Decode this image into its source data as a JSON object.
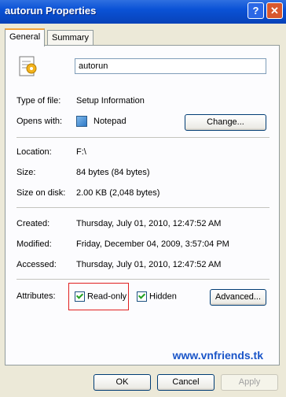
{
  "window": {
    "title": "autorun Properties",
    "help_label": "?",
    "close_label": "✕"
  },
  "tabs": [
    {
      "label": "General"
    },
    {
      "label": "Summary"
    }
  ],
  "file": {
    "name": "autorun",
    "icon": "setup-info-icon"
  },
  "fields": {
    "type_label": "Type of file:",
    "type_value": "Setup Information",
    "opens_label": "Opens with:",
    "opens_value": "Notepad",
    "change_button": "Change...",
    "location_label": "Location:",
    "location_value": "F:\\",
    "size_label": "Size:",
    "size_value": "84 bytes (84 bytes)",
    "size_on_disk_label": "Size on disk:",
    "size_on_disk_value": "2.00 KB (2,048 bytes)",
    "created_label": "Created:",
    "created_value": "Thursday, July 01, 2010, 12:47:52 AM",
    "modified_label": "Modified:",
    "modified_value": "Friday, December 04, 2009, 3:57:04 PM",
    "accessed_label": "Accessed:",
    "accessed_value": "Thursday, July 01, 2010, 12:47:52 AM",
    "attributes_label": "Attributes:",
    "readonly_label": "Read-only",
    "hidden_label": "Hidden",
    "advanced_button": "Advanced..."
  },
  "watermark": "www.vnfriends.tk",
  "buttons": {
    "ok": "OK",
    "cancel": "Cancel",
    "apply": "Apply"
  },
  "colors": {
    "accent": "#0a52d6",
    "highlight": "#e02020"
  }
}
